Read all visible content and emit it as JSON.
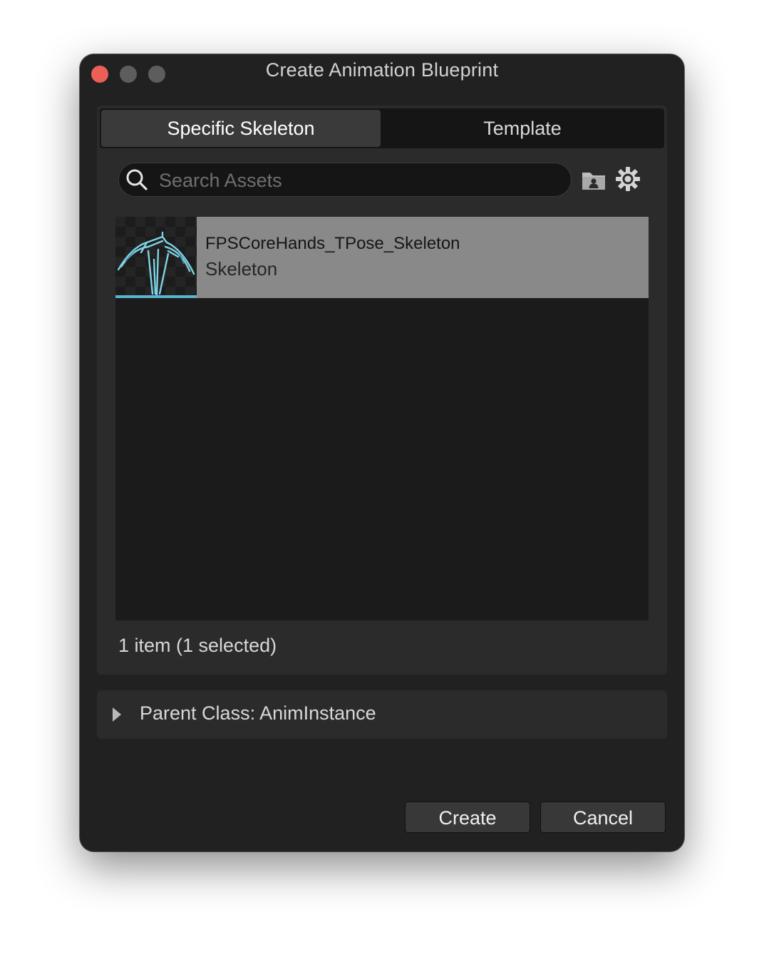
{
  "window": {
    "title": "Create Animation Blueprint",
    "controls": [
      "close-icon",
      "minimize-icon",
      "maximize-icon"
    ]
  },
  "tabs": [
    {
      "label": "Specific Skeleton",
      "active": true
    },
    {
      "label": "Template",
      "active": false
    }
  ],
  "search": {
    "placeholder": "Search Assets",
    "value": ""
  },
  "toolbar_icons": [
    "folder-icon",
    "settings-gear-icon"
  ],
  "assets": [
    {
      "name": "FPSCoreHands_TPose_Skeleton",
      "type": "Skeleton",
      "selected": true,
      "thumbnail": "skeleton-thumbnail-icon"
    }
  ],
  "status": "1 item (1 selected)",
  "parent_class": {
    "label": "Parent Class: AnimInstance",
    "expanded": false
  },
  "buttons": {
    "create": "Create",
    "cancel": "Cancel"
  },
  "colors": {
    "window_bg": "#212121",
    "panel_bg": "#2b2b2b",
    "selected_row": "#898989",
    "accent": "#5ab4cf",
    "close_button": "#ec5f57"
  }
}
